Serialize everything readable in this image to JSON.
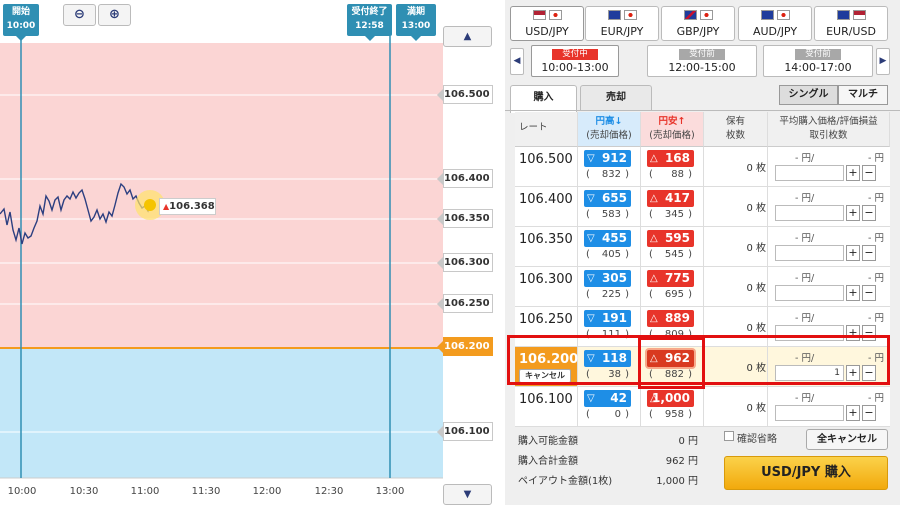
{
  "chart": {
    "zoom_out_icon": "zoom-out-icon",
    "zoom_in_icon": "zoom-in-icon",
    "start_label": "開始",
    "start_time": "10:00",
    "close_label": "受付終了",
    "close_time": "12:58",
    "expiry_label": "満期",
    "expiry_time": "13:00",
    "current_price": "106.368",
    "price_labels": [
      "106.500",
      "106.400",
      "106.350",
      "106.300",
      "106.250",
      "106.200",
      "106.100"
    ],
    "x_labels": [
      "10:00",
      "10:30",
      "11:00",
      "11:30",
      "12:00",
      "12:30",
      "13:00"
    ],
    "colors": {
      "upper_zone": "#fbd5d4",
      "lower_zone": "#c2e7f8",
      "line": "#2c3f80",
      "target": "#f39b1e",
      "time_marker": "#2f8fb3"
    }
  },
  "pairs": [
    {
      "label": "USD/JPY",
      "flags": [
        "us",
        "jp"
      ],
      "selected": true
    },
    {
      "label": "EUR/JPY",
      "flags": [
        "eu",
        "jp"
      ],
      "selected": false
    },
    {
      "label": "GBP/JPY",
      "flags": [
        "gb",
        "jp"
      ],
      "selected": false
    },
    {
      "label": "AUD/JPY",
      "flags": [
        "au",
        "jp"
      ],
      "selected": false
    },
    {
      "label": "EUR/USD",
      "flags": [
        "eu",
        "us"
      ],
      "selected": false
    }
  ],
  "sessions": [
    {
      "status": "受付中",
      "time": "10:00-13:00",
      "active": true
    },
    {
      "status": "受付前",
      "time": "12:00-15:00",
      "active": false
    },
    {
      "status": "受付前",
      "time": "14:00-17:00",
      "active": false
    }
  ],
  "mode_tabs": {
    "buy": "購入",
    "sell": "売却"
  },
  "order_type": {
    "single": "シングル",
    "multi": "マルチ"
  },
  "table": {
    "headers": {
      "rate": "レート",
      "high": "円高↓",
      "high_sub": "(売却価格)",
      "low": "円安↑",
      "low_sub": "(売却価格)",
      "hold": "保有",
      "hold_sub": "枚数",
      "avg": "平均購入価格/評価損益",
      "avg_sub": "取引枚数"
    },
    "rows": [
      {
        "rate": "106.500",
        "high": "912",
        "high_sell": "832",
        "low": "168",
        "low_sell": "88",
        "qty": "0 枚",
        "avg_left": "- 円/",
        "avg_right": "- 円",
        "input": ""
      },
      {
        "rate": "106.400",
        "high": "655",
        "high_sell": "583",
        "low": "417",
        "low_sell": "345",
        "qty": "0 枚",
        "avg_left": "- 円/",
        "avg_right": "- 円",
        "input": ""
      },
      {
        "rate": "106.350",
        "high": "455",
        "high_sell": "405",
        "low": "595",
        "low_sell": "545",
        "qty": "0 枚",
        "avg_left": "- 円/",
        "avg_right": "- 円",
        "input": ""
      },
      {
        "rate": "106.300",
        "high": "305",
        "high_sell": "225",
        "low": "775",
        "low_sell": "695",
        "qty": "0 枚",
        "avg_left": "- 円/",
        "avg_right": "- 円",
        "input": ""
      },
      {
        "rate": "106.250",
        "high": "191",
        "high_sell": "111",
        "low": "889",
        "low_sell": "809",
        "qty": "0 枚",
        "avg_left": "- 円/",
        "avg_right": "- 円",
        "input": ""
      },
      {
        "rate": "106.200",
        "high": "118",
        "high_sell": "38",
        "low": "962",
        "low_sell": "882",
        "qty": "0 枚",
        "avg_left": "- 円/",
        "avg_right": "- 円",
        "input": "1",
        "cancel": "キャンセル"
      },
      {
        "rate": "106.100",
        "high": "42",
        "high_sell": "0",
        "low": "1,000",
        "low_sell": "958",
        "qty": "0 枚",
        "avg_left": "- 円/",
        "avg_right": "- 円",
        "input": ""
      }
    ]
  },
  "footer": {
    "available_label": "購入可能金額",
    "available_value": "0 円",
    "total_label": "購入合計金額",
    "total_value": "962 円",
    "payout_label": "ペイアウト金額(1枚)",
    "payout_value": "1,000 円",
    "confirm_skip": "確認省略",
    "cancel_all": "全キャンセル",
    "buy_button": "USD/JPY 購入"
  },
  "plus": "+",
  "minus": "−"
}
